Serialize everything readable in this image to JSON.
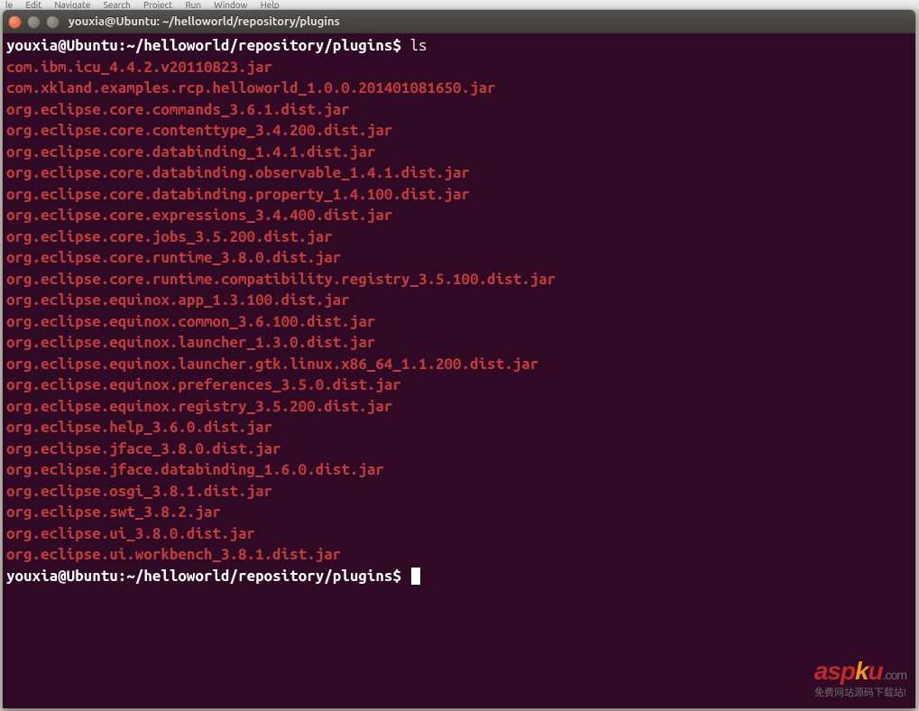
{
  "menubar": {
    "items": [
      "le",
      "Edit",
      "Navigate",
      "Search",
      "Project",
      "Run",
      "Window",
      "Help"
    ]
  },
  "window": {
    "title": "youxia@Ubuntu: ~/helloworld/repository/plugins"
  },
  "terminal": {
    "prompt_user": "youxia@Ubuntu",
    "prompt_colon": ":",
    "prompt_path": "~/helloworld/repository/plugins",
    "prompt_dollar": "$",
    "command": "ls",
    "files": [
      "com.ibm.icu_4.4.2.v20110823.jar",
      "com.xkland.examples.rcp.helloworld_1.0.0.201401081650.jar",
      "org.eclipse.core.commands_3.6.1.dist.jar",
      "org.eclipse.core.contenttype_3.4.200.dist.jar",
      "org.eclipse.core.databinding_1.4.1.dist.jar",
      "org.eclipse.core.databinding.observable_1.4.1.dist.jar",
      "org.eclipse.core.databinding.property_1.4.100.dist.jar",
      "org.eclipse.core.expressions_3.4.400.dist.jar",
      "org.eclipse.core.jobs_3.5.200.dist.jar",
      "org.eclipse.core.runtime_3.8.0.dist.jar",
      "org.eclipse.core.runtime.compatibility.registry_3.5.100.dist.jar",
      "org.eclipse.equinox.app_1.3.100.dist.jar",
      "org.eclipse.equinox.common_3.6.100.dist.jar",
      "org.eclipse.equinox.launcher_1.3.0.dist.jar",
      "org.eclipse.equinox.launcher.gtk.linux.x86_64_1.1.200.dist.jar",
      "org.eclipse.equinox.preferences_3.5.0.dist.jar",
      "org.eclipse.equinox.registry_3.5.200.dist.jar",
      "org.eclipse.help_3.6.0.dist.jar",
      "org.eclipse.jface_3.8.0.dist.jar",
      "org.eclipse.jface.databinding_1.6.0.dist.jar",
      "org.eclipse.osgi_3.8.1.dist.jar",
      "org.eclipse.swt_3.8.2.jar",
      "org.eclipse.ui_3.8.0.dist.jar",
      "org.eclipse.ui.workbench_3.8.1.dist.jar"
    ]
  },
  "watermark": {
    "brand_a": "asp",
    "brand_k": "k",
    "brand_u": "u",
    "dotcom": ".com",
    "subtitle": "免费网站源码下载站!"
  }
}
